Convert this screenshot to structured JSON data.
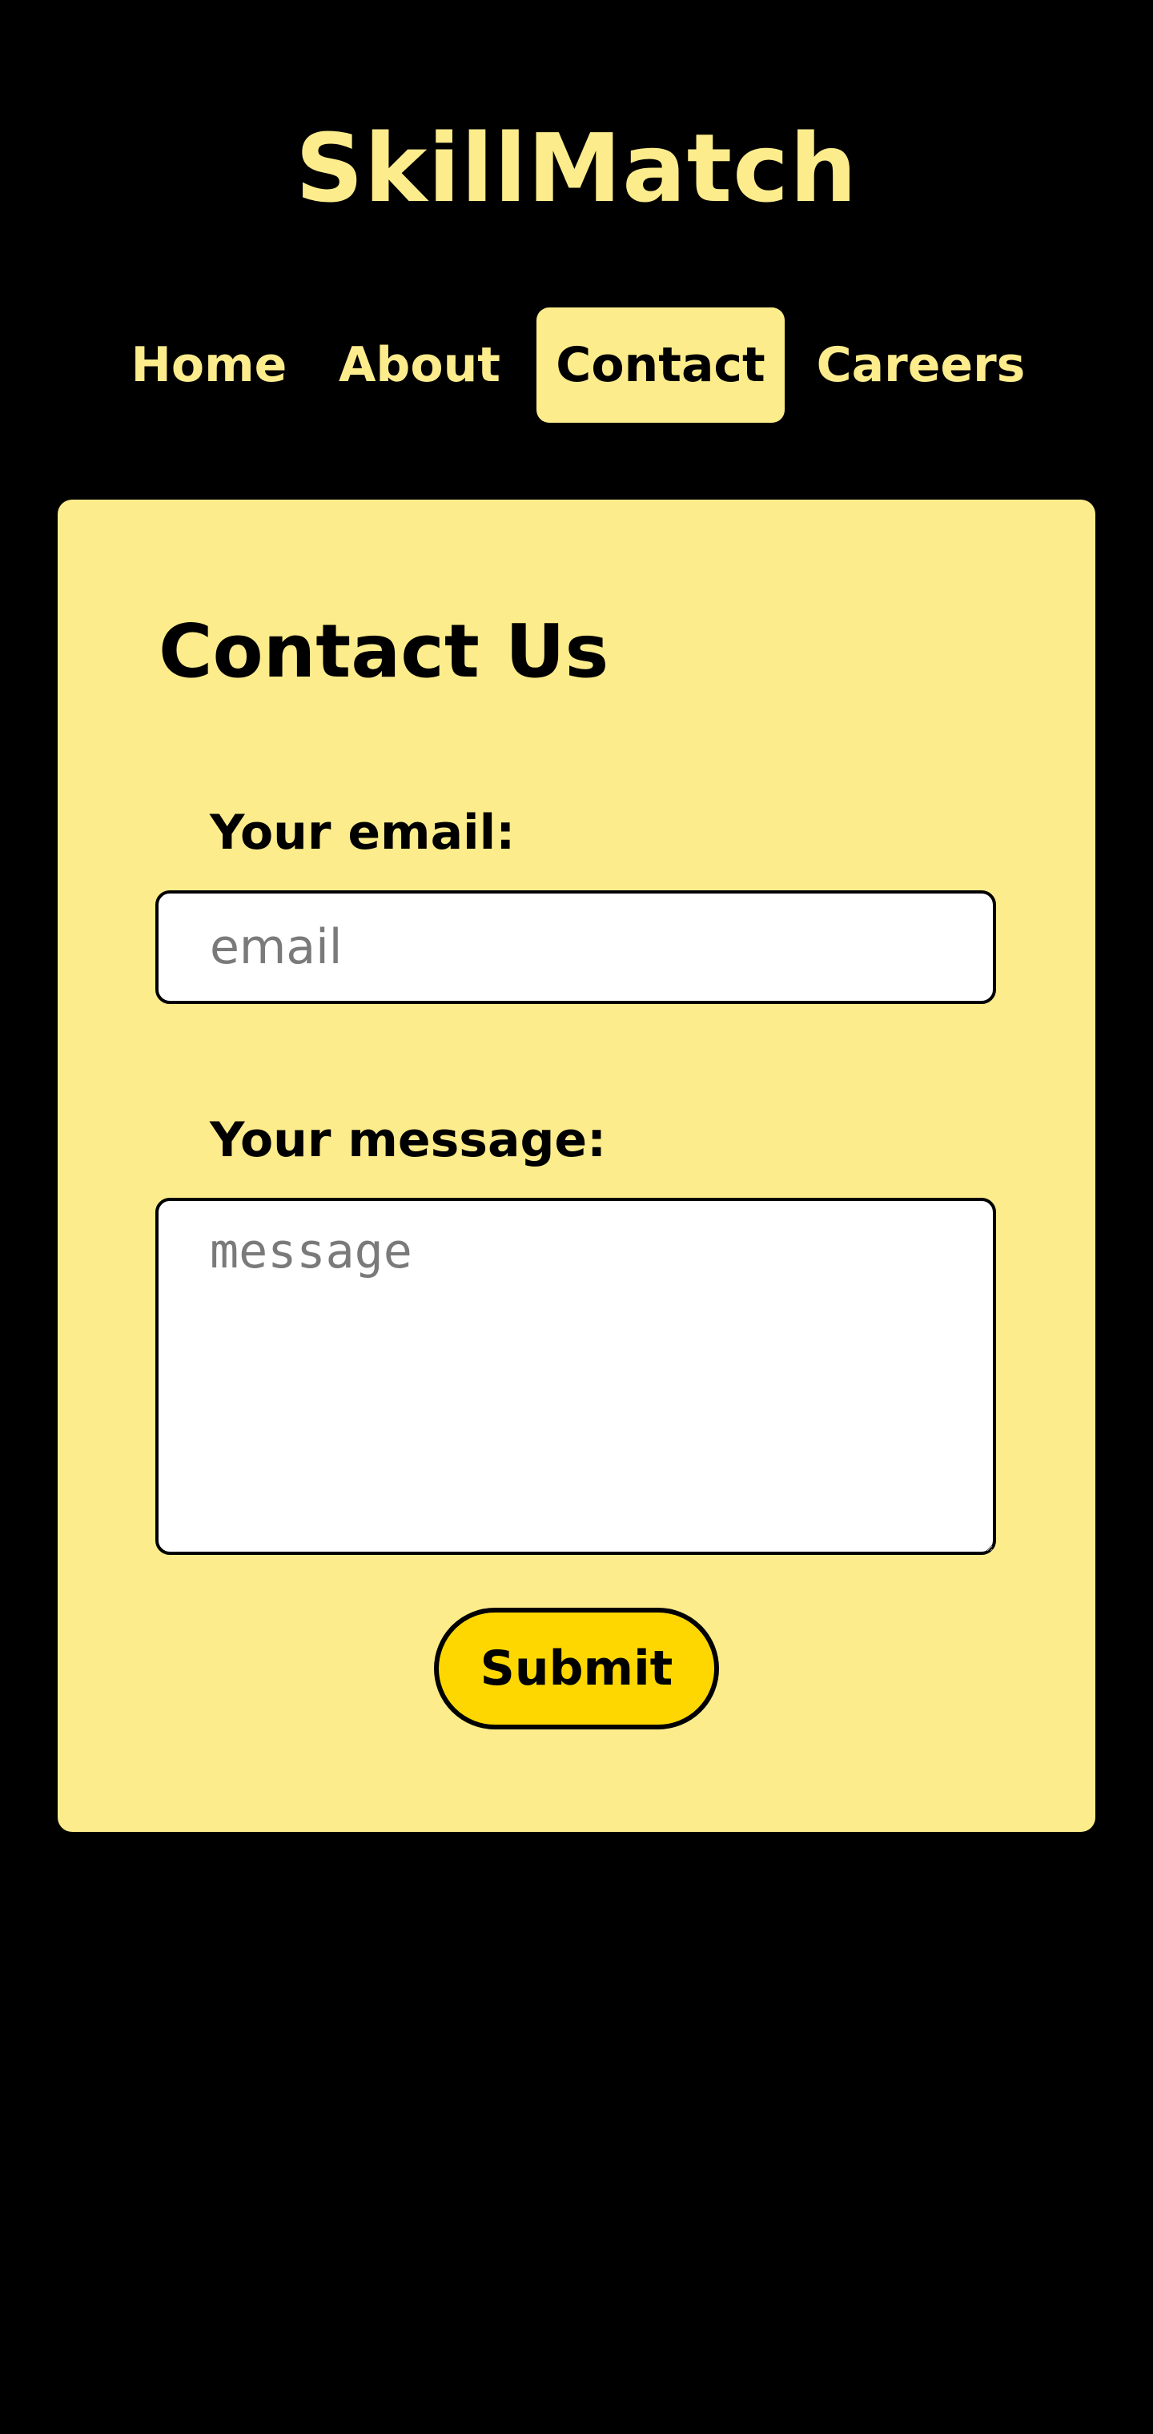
{
  "header": {
    "brand": "SkillMatch"
  },
  "nav": {
    "items": [
      {
        "label": "Home"
      },
      {
        "label": "About"
      },
      {
        "label": "Contact"
      },
      {
        "label": "Careers"
      }
    ]
  },
  "contact": {
    "title": "Contact Us",
    "email_label": "Your email:",
    "email_placeholder": "email",
    "message_label": "Your message:",
    "message_placeholder": "message",
    "submit_label": "Submit"
  },
  "colors": {
    "background": "#000000",
    "accent_light": "#FCEC8C",
    "button": "#FFD700"
  }
}
